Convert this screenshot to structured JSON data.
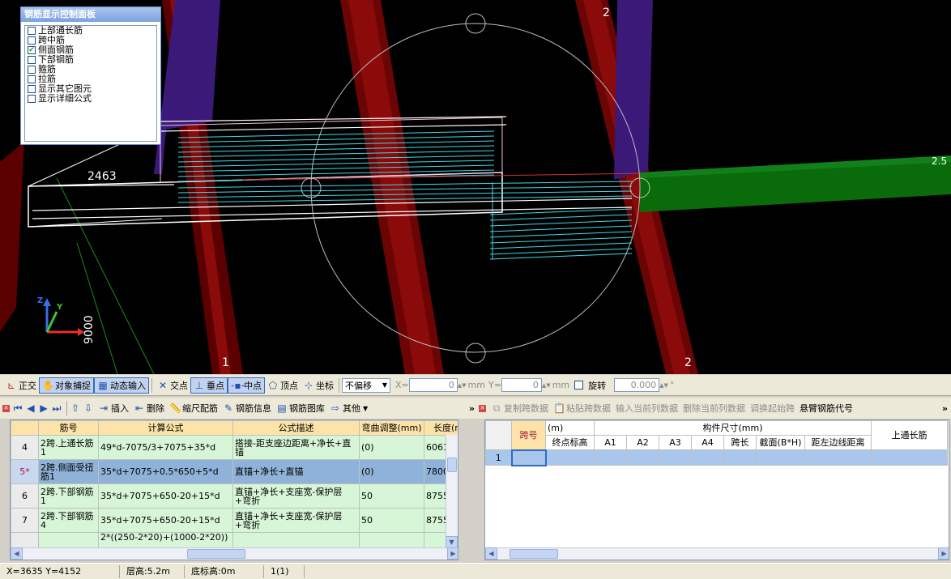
{
  "panel": {
    "title": "钢筋显示控制面板",
    "items": [
      {
        "label": "上部通长筋",
        "checked": false
      },
      {
        "label": "跨中筋",
        "checked": false
      },
      {
        "label": "侧面钢筋",
        "checked": true
      },
      {
        "label": "下部钢筋",
        "checked": false
      },
      {
        "label": "箍筋",
        "checked": false
      },
      {
        "label": "拉筋",
        "checked": false
      },
      {
        "label": "显示其它图元",
        "checked": false
      },
      {
        "label": "显示详细公式",
        "checked": false
      }
    ]
  },
  "viewport": {
    "dim_label": "2463",
    "label_9000": "9000",
    "axis_1": "1",
    "axis_2_top": "2",
    "axis_2_bottom": "2",
    "axis_z": "Z",
    "axis_y": "Y",
    "right_edge": "2.5"
  },
  "toolbar": {
    "ortho": "正交",
    "snap": "对象捕捉",
    "dyninput": "动态输入",
    "intersection": "交点",
    "perp": "垂点",
    "mid": "中点",
    "vertex": "顶点",
    "coord": "坐标",
    "offset": "不偏移",
    "x_label": "X=",
    "x_value": "0",
    "y_label": "Y=",
    "y_value": "0",
    "unit": "mm",
    "rotate": "旋转",
    "rotate_value": "0.000",
    "deg": "°"
  },
  "left_toolbar": {
    "insert": "插入",
    "delete": "删除",
    "scale": "缩尺配筋",
    "info": "钢筋信息",
    "library": "钢筋图库",
    "other": "其他"
  },
  "right_toolbar": {
    "copy": "复制跨数据",
    "paste": "粘贴跨数据",
    "input_col": "输入当前列数据",
    "delete_col": "删除当前列数据",
    "swap": "调换起始跨",
    "cantilever": "悬臂钢筋代号"
  },
  "left_table": {
    "headers": [
      "筋号",
      "计算公式",
      "公式描述",
      "弯曲调整(mm)",
      "长度(m"
    ],
    "rows": [
      {
        "num": "4",
        "name": "2跨.上通长筋1",
        "formula": "49*d-7075/3+7075+35*d",
        "desc": "搭接-距支座边距离+净长+直锚",
        "adjust": "(0)",
        "length": "6061"
      },
      {
        "num": "5*",
        "name": "2跨.侧面受扭筋1",
        "formula": "35*d+7075+0.5*650+5*d",
        "desc": "直锚+净长+直锚",
        "adjust": "(0)",
        "length": "7800"
      },
      {
        "num": "6",
        "name": "2跨.下部钢筋1",
        "formula": "35*d+7075+650-20+15*d",
        "desc": "直锚+净长+支座宽-保护层+弯折",
        "adjust": "50",
        "length": "8755"
      },
      {
        "num": "7",
        "name": "2跨.下部钢筋4",
        "formula": "35*d+7075+650-20+15*d",
        "desc": "直锚+净长+支座宽-保护层+弯折",
        "adjust": "50",
        "length": "8755"
      }
    ],
    "partial_row": "2*((250-2*20)+(1000-2*20))"
  },
  "right_table": {
    "span_header": "跨号",
    "group_left": "(m)",
    "group_size": "构件尺寸(mm)",
    "top_rebar": "上通长筋",
    "subheaders": [
      "终点标高",
      "A1",
      "A2",
      "A3",
      "A4",
      "跨长",
      "截面(B*H)",
      "距左边线距离"
    ],
    "row_num": "1"
  },
  "status": {
    "coords": "X=3635 Y=4152",
    "floor_height": "层高:5.2m",
    "base_elev": "底标高:0m",
    "page": "1(1)"
  }
}
